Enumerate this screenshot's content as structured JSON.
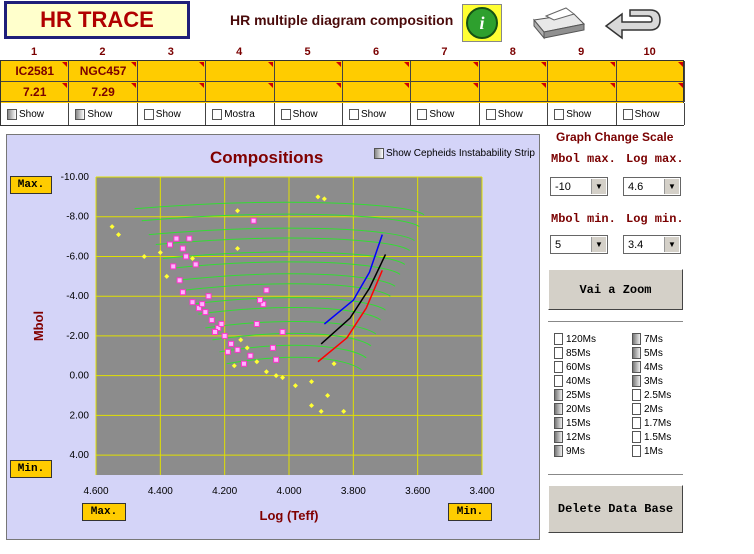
{
  "header": {
    "app_title": "HR TRACE",
    "subtitle": "HR multiple diagram composition"
  },
  "icons": {
    "info": "info-icon",
    "print": "printer-icon",
    "back": "back-arrow-icon"
  },
  "slots": [
    {
      "num": "1",
      "name": "IC2581",
      "age": "7.21",
      "show": "Show",
      "dark": true
    },
    {
      "num": "2",
      "name": "NGC457",
      "age": "7.29",
      "show": "Show",
      "dark": true
    },
    {
      "num": "3",
      "name": "",
      "age": "",
      "show": "Show",
      "dark": false
    },
    {
      "num": "4",
      "name": "",
      "age": "",
      "show": "Mostra",
      "dark": false
    },
    {
      "num": "5",
      "name": "",
      "age": "",
      "show": "Show",
      "dark": false
    },
    {
      "num": "6",
      "name": "",
      "age": "",
      "show": "Show",
      "dark": false
    },
    {
      "num": "7",
      "name": "",
      "age": "",
      "show": "Show",
      "dark": false
    },
    {
      "num": "8",
      "name": "",
      "age": "",
      "show": "Show",
      "dark": false
    },
    {
      "num": "9",
      "name": "",
      "age": "",
      "show": "Show",
      "dark": false
    },
    {
      "num": "10",
      "name": "",
      "age": "",
      "show": "Show",
      "dark": false
    }
  ],
  "chart": {
    "title": "Compositions",
    "cepheid_label": "Show Cepheids Instabability Strip",
    "max_label": "Max.",
    "min_label": "Min."
  },
  "chart_data": {
    "type": "scatter",
    "title": "Compositions",
    "xlabel": "Log (Teff)",
    "ylabel": "Mbol",
    "xlim": [
      4.6,
      3.4
    ],
    "ylim": [
      5,
      -10
    ],
    "x_ticks": [
      "4.600",
      "4.400",
      "4.200",
      "4.000",
      "3.800",
      "3.600",
      "3.400"
    ],
    "y_ticks": [
      "-10.00",
      "-8.00",
      "-6.00",
      "-4.00",
      "-2.00",
      "0.00",
      "2.00",
      "4.00"
    ],
    "grid": true,
    "series": [
      {
        "name": "IC2581",
        "color": "#ff33cc",
        "marker": "square",
        "points": [
          [
            4.37,
            -6.6
          ],
          [
            4.35,
            -6.9
          ],
          [
            4.33,
            -6.4
          ],
          [
            4.31,
            -6.9
          ],
          [
            4.32,
            -6.0
          ],
          [
            4.29,
            -5.6
          ],
          [
            4.36,
            -5.5
          ],
          [
            4.34,
            -4.8
          ],
          [
            4.33,
            -4.2
          ],
          [
            4.3,
            -3.7
          ],
          [
            4.28,
            -3.4
          ],
          [
            4.26,
            -3.2
          ],
          [
            4.24,
            -2.8
          ],
          [
            4.22,
            -2.4
          ],
          [
            4.2,
            -2.0
          ],
          [
            4.18,
            -1.6
          ],
          [
            4.16,
            -1.3
          ],
          [
            4.12,
            -1.0
          ],
          [
            4.1,
            -2.6
          ],
          [
            4.08,
            -3.6
          ],
          [
            4.07,
            -4.3
          ],
          [
            4.05,
            -1.4
          ],
          [
            4.04,
            -0.8
          ],
          [
            4.02,
            -2.2
          ],
          [
            4.21,
            -2.6
          ],
          [
            4.23,
            -2.2
          ],
          [
            4.19,
            -1.2
          ],
          [
            4.14,
            -0.6
          ],
          [
            4.25,
            -4.0
          ],
          [
            4.27,
            -3.6
          ],
          [
            4.11,
            -7.8
          ],
          [
            4.09,
            -3.8
          ]
        ]
      },
      {
        "name": "NGC457",
        "color": "#ffff33",
        "marker": "diamond",
        "points": [
          [
            4.55,
            -7.5
          ],
          [
            4.53,
            -7.1
          ],
          [
            4.45,
            -6.0
          ],
          [
            4.4,
            -6.2
          ],
          [
            4.38,
            -5.0
          ],
          [
            4.3,
            -5.9
          ],
          [
            4.16,
            -6.4
          ],
          [
            4.16,
            -8.3
          ],
          [
            3.91,
            -9.0
          ],
          [
            3.89,
            -8.9
          ],
          [
            4.15,
            -1.8
          ],
          [
            4.13,
            -1.4
          ],
          [
            4.1,
            -0.7
          ],
          [
            4.07,
            -0.2
          ],
          [
            4.04,
            0.0
          ],
          [
            4.02,
            0.1
          ],
          [
            3.98,
            0.5
          ],
          [
            3.93,
            0.3
          ],
          [
            3.88,
            1.0
          ],
          [
            3.83,
            1.8
          ],
          [
            3.86,
            -0.6
          ],
          [
            3.93,
            1.5
          ],
          [
            3.9,
            1.8
          ],
          [
            4.17,
            -0.5
          ]
        ]
      }
    ],
    "tracks": [
      {
        "name": "Cepheid-blue",
        "color": "#0000ff",
        "points": [
          [
            3.89,
            -2.6
          ],
          [
            3.8,
            -3.8
          ],
          [
            3.75,
            -5.2
          ],
          [
            3.71,
            -7.1
          ]
        ]
      },
      {
        "name": "Cepheid-black",
        "color": "#000000",
        "points": [
          [
            3.9,
            -1.6
          ],
          [
            3.81,
            -2.9
          ],
          [
            3.75,
            -4.4
          ],
          [
            3.7,
            -6.1
          ]
        ]
      },
      {
        "name": "Cepheid-red",
        "color": "#ff0000",
        "points": [
          [
            3.91,
            -0.7
          ],
          [
            3.82,
            -1.9
          ],
          [
            3.76,
            -3.4
          ],
          [
            3.71,
            -5.3
          ]
        ]
      }
    ]
  },
  "controls": {
    "scale_title": "Graph Change Scale",
    "mbol_max_label": "Mbol max.",
    "log_max_label": "Log max.",
    "mbol_max_value": "-10",
    "log_max_value": "4.6",
    "mbol_min_label": "Mbol min.",
    "log_min_label": "Log min.",
    "mbol_min_value": "5",
    "log_min_value": "3.4",
    "zoom_button": "Vai a Zoom",
    "delete_button": "Delete Data Base"
  },
  "masses_left": [
    {
      "label": "120Ms",
      "dark": false
    },
    {
      "label": "85Ms",
      "dark": false
    },
    {
      "label": "60Ms",
      "dark": false
    },
    {
      "label": "40Ms",
      "dark": false
    },
    {
      "label": "25Ms",
      "dark": true
    },
    {
      "label": "20Ms",
      "dark": true
    },
    {
      "label": "15Ms",
      "dark": true
    },
    {
      "label": "12Ms",
      "dark": true
    },
    {
      "label": "9Ms",
      "dark": true
    }
  ],
  "masses_right": [
    {
      "label": "7Ms",
      "dark": true
    },
    {
      "label": "5Ms",
      "dark": true
    },
    {
      "label": "4Ms",
      "dark": true
    },
    {
      "label": "3Ms",
      "dark": true
    },
    {
      "label": "2.5Ms",
      "dark": false
    },
    {
      "label": "2Ms",
      "dark": false
    },
    {
      "label": "1.7Ms",
      "dark": false
    },
    {
      "label": "1.5Ms",
      "dark": false
    },
    {
      "label": "1Ms",
      "dark": false
    }
  ]
}
